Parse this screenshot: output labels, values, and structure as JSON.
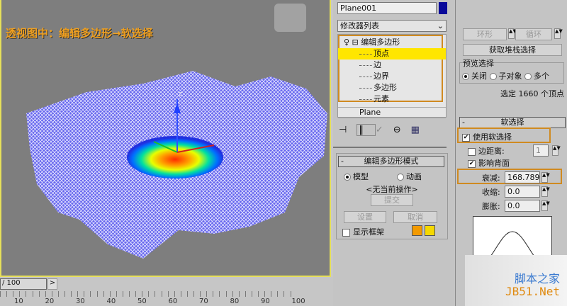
{
  "viewport": {
    "title": "透视图中：编辑多边形→软选择",
    "gizmo_label": "z"
  },
  "timeline": {
    "frame": "/ 100",
    "next": ">",
    "labels": [
      "10",
      "20",
      "30",
      "40",
      "50",
      "60",
      "70",
      "80",
      "90",
      "100"
    ]
  },
  "object": {
    "name": "Plane001",
    "color": "#0a0a9a"
  },
  "modifier_list": {
    "label": "修改器列表",
    "arrow": "⌄"
  },
  "stack": {
    "modifier": "编辑多边形",
    "items": [
      "顶点",
      "边",
      "边界",
      "多边形",
      "元素"
    ],
    "selected": "顶点",
    "base": "Plane"
  },
  "selection": {
    "ring": "环形",
    "loop": "循环",
    "get_stack": "获取堆栈选择",
    "preview_label": "预览选择",
    "preview_options": [
      "关闭",
      "子对象",
      "多个"
    ],
    "preview_selected": "关闭",
    "status": "选定 1660 个顶点"
  },
  "edit_mode": {
    "title": "编辑多边形模式",
    "minus": "-",
    "model": "模型",
    "animate": "动画",
    "no_op": "<无当前操作>",
    "commit": "提交",
    "settings": "设置",
    "cancel": "取消",
    "show_cage": "显示框架",
    "cage_colors": [
      "#f39a00",
      "#f5d800"
    ]
  },
  "soft": {
    "title": "软选择",
    "minus": "-",
    "use_soft": "使用软选择",
    "edge_dist": "边距离:",
    "edge_dist_value": "1",
    "affect_back": "影响背面",
    "falloff": "衰减:",
    "falloff_value": "168.789",
    "pinch": "收缩:",
    "pinch_value": "0.0",
    "bubble": "膨胀:",
    "bubble_value": "0.0"
  },
  "watermark": {
    "line1": "脚本之家",
    "line2": "JB51.Net"
  }
}
